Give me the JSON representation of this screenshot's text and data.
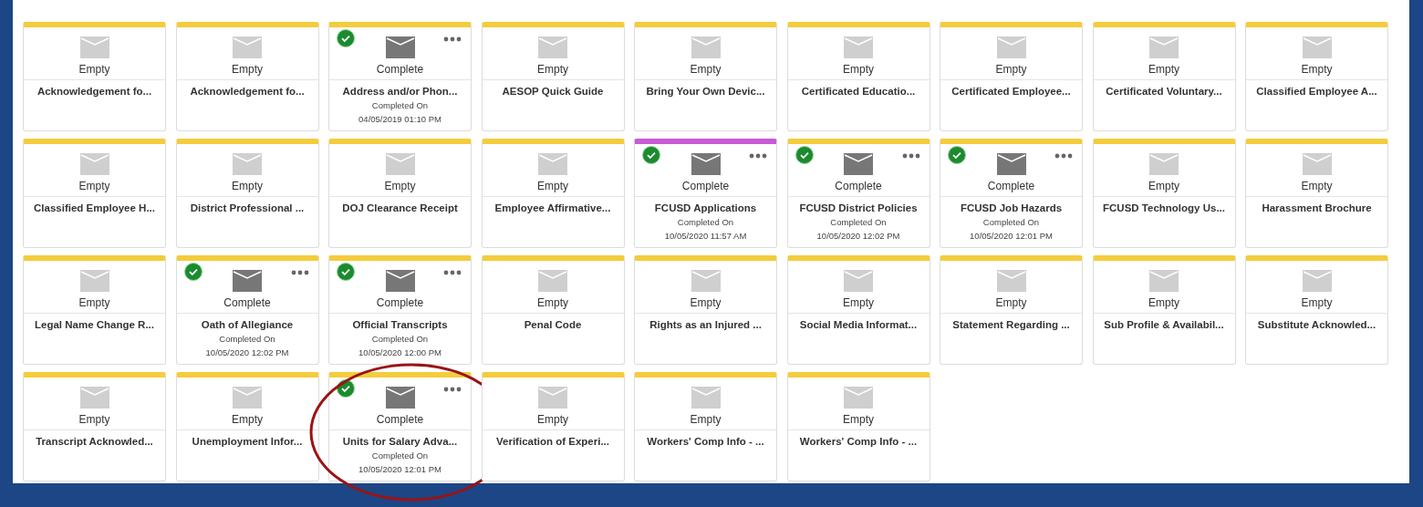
{
  "cards": [
    {
      "kind": "empty",
      "color": "#f4cc3c",
      "status": "Empty",
      "title": "Acknowledgement fo...",
      "highlighted": false
    },
    {
      "kind": "empty",
      "color": "#f4cc3c",
      "status": "Empty",
      "title": "Acknowledgement fo...",
      "highlighted": false
    },
    {
      "kind": "complete",
      "color": "#f4cc3c",
      "status": "Complete",
      "title": "Address and/or Phon...",
      "completed_label": "Completed On",
      "completed_date": "04/05/2019 01:10 PM",
      "highlighted": false
    },
    {
      "kind": "empty",
      "color": "#f4cc3c",
      "status": "Empty",
      "title": "AESOP Quick Guide",
      "highlighted": false
    },
    {
      "kind": "empty",
      "color": "#f4cc3c",
      "status": "Empty",
      "title": "Bring Your Own Devic...",
      "highlighted": false
    },
    {
      "kind": "empty",
      "color": "#f4cc3c",
      "status": "Empty",
      "title": "Certificated Educatio...",
      "highlighted": false
    },
    {
      "kind": "empty",
      "color": "#f4cc3c",
      "status": "Empty",
      "title": "Certificated Employee...",
      "highlighted": false
    },
    {
      "kind": "empty",
      "color": "#f4cc3c",
      "status": "Empty",
      "title": "Certificated Voluntary...",
      "highlighted": false
    },
    {
      "kind": "empty",
      "color": "#f4cc3c",
      "status": "Empty",
      "title": "Classified Employee A...",
      "highlighted": false
    },
    {
      "kind": "empty",
      "color": "#f4cc3c",
      "status": "Empty",
      "title": "Classified Employee H...",
      "highlighted": false
    },
    {
      "kind": "empty",
      "color": "#f4cc3c",
      "status": "Empty",
      "title": "District Professional ...",
      "highlighted": false
    },
    {
      "kind": "empty",
      "color": "#f4cc3c",
      "status": "Empty",
      "title": "DOJ Clearance Receipt",
      "highlighted": false
    },
    {
      "kind": "empty",
      "color": "#f4cc3c",
      "status": "Empty",
      "title": "Employee Affirmative...",
      "highlighted": false
    },
    {
      "kind": "complete",
      "color": "#c95ad6",
      "status": "Complete",
      "title": "FCUSD Applications",
      "completed_label": "Completed On",
      "completed_date": "10/05/2020 11:57 AM",
      "highlighted": false
    },
    {
      "kind": "complete",
      "color": "#f4cc3c",
      "status": "Complete",
      "title": "FCUSD District Policies",
      "completed_label": "Completed On",
      "completed_date": "10/05/2020 12:02 PM",
      "highlighted": false
    },
    {
      "kind": "complete",
      "color": "#f4cc3c",
      "status": "Complete",
      "title": "FCUSD Job Hazards",
      "completed_label": "Completed On",
      "completed_date": "10/05/2020 12:01 PM",
      "highlighted": false
    },
    {
      "kind": "empty",
      "color": "#f4cc3c",
      "status": "Empty",
      "title": "FCUSD Technology Us...",
      "highlighted": false
    },
    {
      "kind": "empty",
      "color": "#f4cc3c",
      "status": "Empty",
      "title": "Harassment Brochure",
      "highlighted": false
    },
    {
      "kind": "empty",
      "color": "#f4cc3c",
      "status": "Empty",
      "title": "Legal Name Change R...",
      "highlighted": false
    },
    {
      "kind": "complete",
      "color": "#f4cc3c",
      "status": "Complete",
      "title": "Oath of Allegiance",
      "completed_label": "Completed On",
      "completed_date": "10/05/2020 12:02 PM",
      "highlighted": false
    },
    {
      "kind": "complete",
      "color": "#f4cc3c",
      "status": "Complete",
      "title": "Official Transcripts",
      "completed_label": "Completed On",
      "completed_date": "10/05/2020 12:00 PM",
      "highlighted": false
    },
    {
      "kind": "empty",
      "color": "#f4cc3c",
      "status": "Empty",
      "title": "Penal Code",
      "highlighted": false
    },
    {
      "kind": "empty",
      "color": "#f4cc3c",
      "status": "Empty",
      "title": "Rights as an Injured ...",
      "highlighted": false
    },
    {
      "kind": "empty",
      "color": "#f4cc3c",
      "status": "Empty",
      "title": "Social Media Informat...",
      "highlighted": false
    },
    {
      "kind": "empty",
      "color": "#f4cc3c",
      "status": "Empty",
      "title": "Statement Regarding ...",
      "highlighted": false
    },
    {
      "kind": "empty",
      "color": "#f4cc3c",
      "status": "Empty",
      "title": "Sub Profile & Availabil...",
      "highlighted": false
    },
    {
      "kind": "empty",
      "color": "#f4cc3c",
      "status": "Empty",
      "title": "Substitute Acknowled...",
      "highlighted": false
    },
    {
      "kind": "empty",
      "color": "#f4cc3c",
      "status": "Empty",
      "title": "Transcript Acknowled...",
      "highlighted": false
    },
    {
      "kind": "empty",
      "color": "#f4cc3c",
      "status": "Empty",
      "title": "Unemployment Infor...",
      "highlighted": false
    },
    {
      "kind": "complete",
      "color": "#f4cc3c",
      "status": "Complete",
      "title": "Units for Salary Adva...",
      "completed_label": "Completed On",
      "completed_date": "10/05/2020 12:01 PM",
      "highlighted": true
    },
    {
      "kind": "empty",
      "color": "#f4cc3c",
      "status": "Empty",
      "title": "Verification of Experi...",
      "highlighted": false
    },
    {
      "kind": "empty",
      "color": "#f4cc3c",
      "status": "Empty",
      "title": "Workers' Comp Info - ...",
      "highlighted": false
    },
    {
      "kind": "empty",
      "color": "#f4cc3c",
      "status": "Empty",
      "title": "Workers' Comp Info - ...",
      "highlighted": false
    }
  ]
}
